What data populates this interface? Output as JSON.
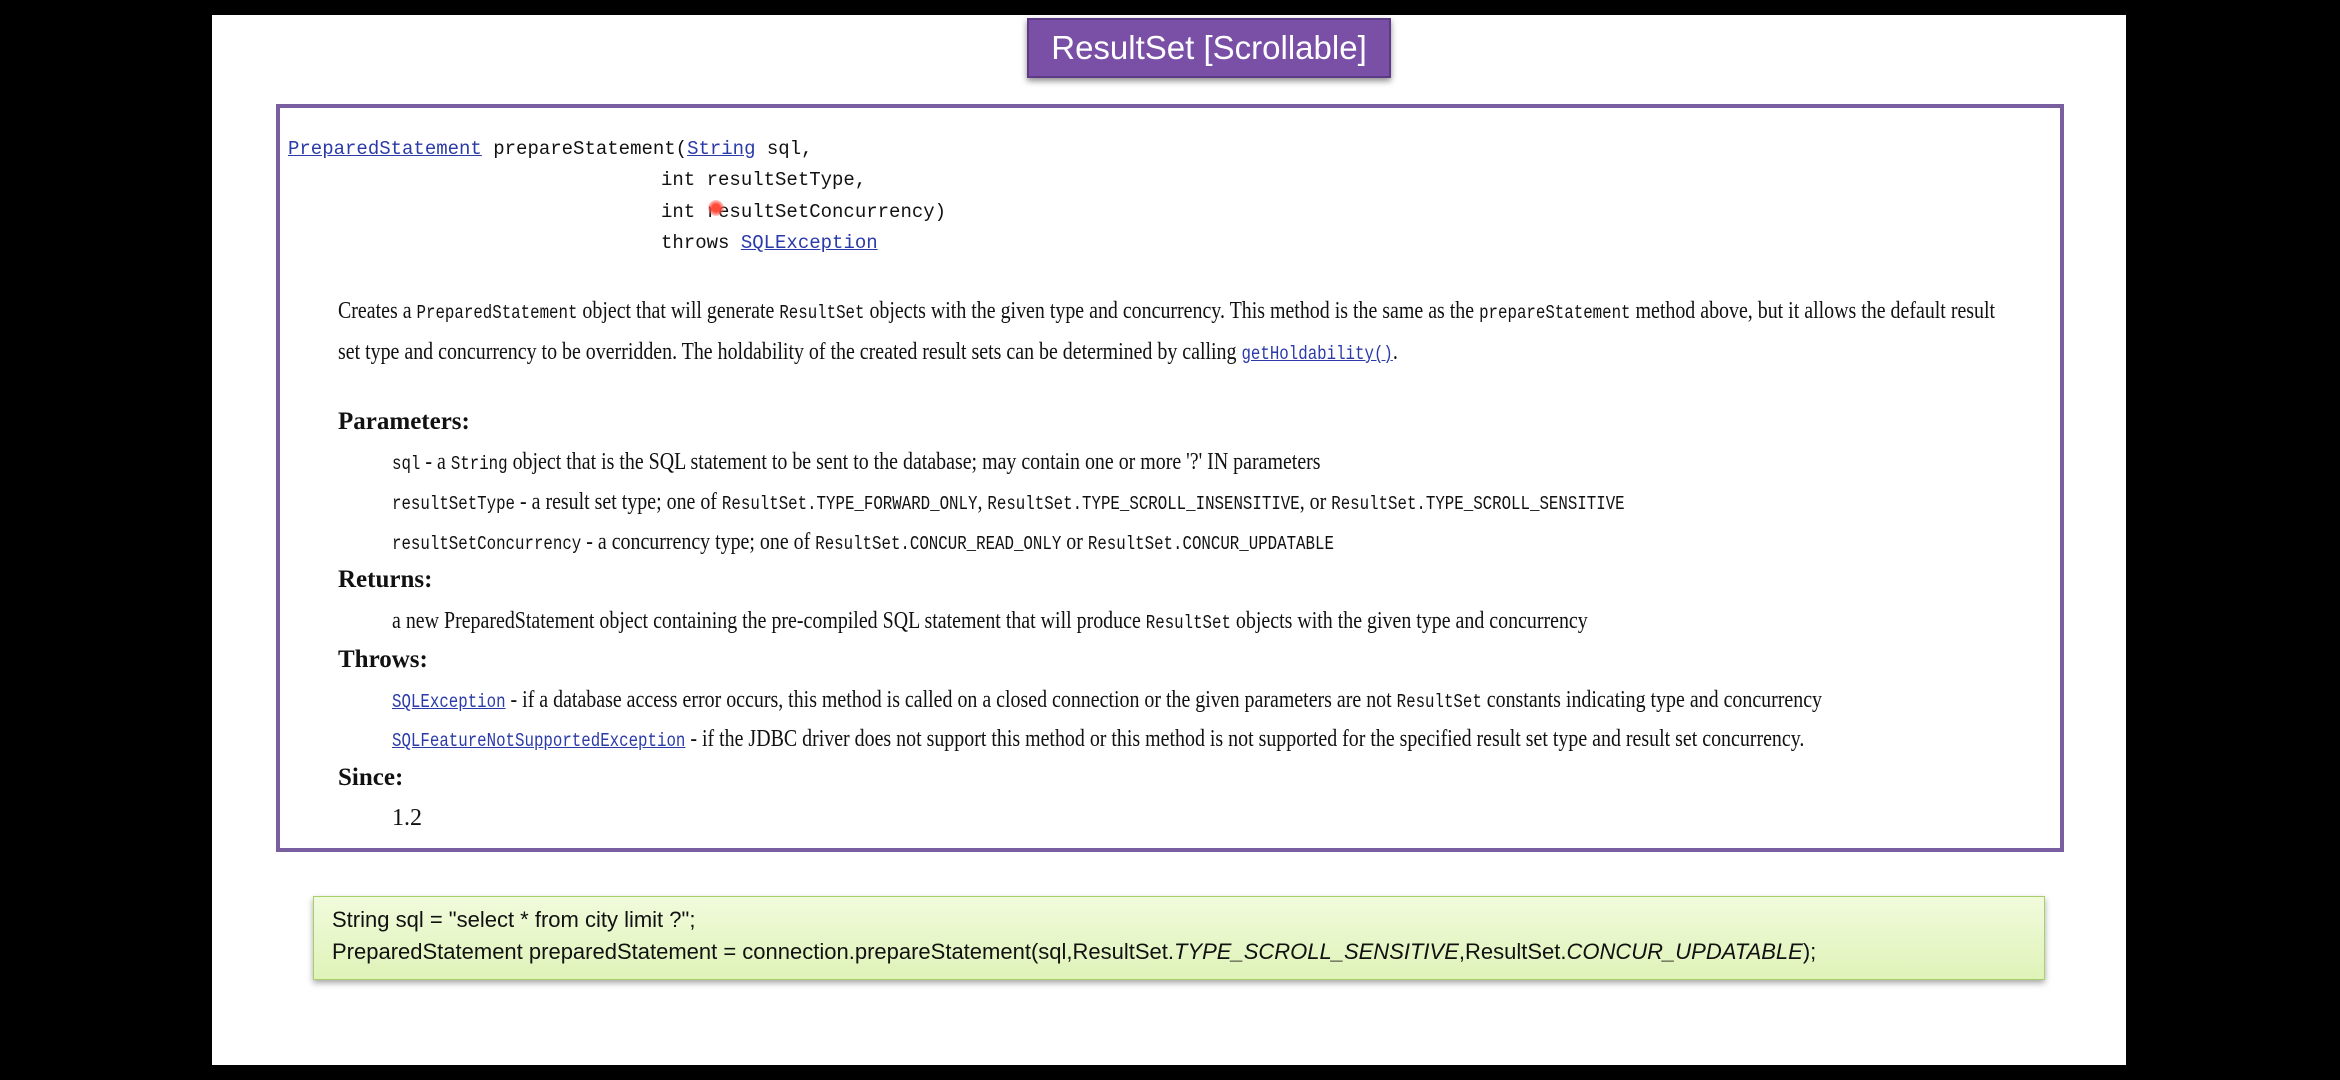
{
  "title": "ResultSet [Scrollable]",
  "signature": {
    "return_type": "PreparedStatement",
    "method": " prepareStatement(",
    "param1_type": "String",
    "param1_name": " sql,",
    "line2": "int resultSetType,",
    "line3": "int resultSetConcurrency)",
    "throws_kw": "throws ",
    "throws_type": "SQLException"
  },
  "description": {
    "l1_a": "Creates a ",
    "l1_code1": "PreparedStatement",
    "l1_b": " object that will generate ",
    "l1_code2": "ResultSet",
    "l1_c": " objects with the given type and concurrency. This method is the same as the ",
    "l1_code3": "prepareStatement",
    "l1_d": " method above, but it allows the default result",
    "l2_a": "set type and concurrency to be overridden. The holdability of the created result sets can be determined by calling ",
    "l2_link": "getHoldability()",
    "l2_b": "."
  },
  "parameters": {
    "header": "Parameters:",
    "p1_name": "sql",
    "p1_a": " - a ",
    "p1_code": "String",
    "p1_b": " object that is the SQL statement to be sent to the database; may contain one or more '?' IN parameters",
    "p2_name": "resultSetType",
    "p2_a": " - a result set type; one of ",
    "p2_c1": "ResultSet.TYPE_FORWARD_ONLY",
    "p2_sep1": ", ",
    "p2_c2": "ResultSet.TYPE_SCROLL_INSENSITIVE",
    "p2_sep2": ", or ",
    "p2_c3": "ResultSet.TYPE_SCROLL_SENSITIVE",
    "p3_name": "resultSetConcurrency",
    "p3_a": " - a concurrency type; one of ",
    "p3_c1": "ResultSet.CONCUR_READ_ONLY",
    "p3_sep": " or ",
    "p3_c2": "ResultSet.CONCUR_UPDATABLE"
  },
  "returns": {
    "header": "Returns:",
    "a": "a new PreparedStatement object containing the pre-compiled SQL statement that will produce ",
    "code": "ResultSet",
    "b": " objects with the given type and concurrency"
  },
  "throws": {
    "header": "Throws:",
    "t1_link": "SQLException",
    "t1_a": " - if a database access error occurs, this method is called on a closed connection or the given parameters are not ",
    "t1_code": "ResultSet",
    "t1_b": " constants indicating type and concurrency",
    "t2_link": "SQLFeatureNotSupportedException",
    "t2_a": " - if the JDBC driver does not support this method or this method is not supported for the specified result set type and result set concurrency."
  },
  "since": {
    "header": "Since:",
    "value": "1.2"
  },
  "code": {
    "line1": "String sql = \"select * from city limit ?\";",
    "line2_a": "PreparedStatement preparedStatement = connection.prepareStatement(sql,ResultSet.",
    "line2_i1": "TYPE_SCROLL_SENSITIVE",
    "line2_b": ",ResultSet.",
    "line2_i2": "CONCUR_UPDATABLE",
    "line2_c": ");"
  },
  "colors": {
    "title_bg": "#7a4fa6",
    "doc_border": "#7a5fa0",
    "link": "#2a3aa8",
    "code_bg": "#e8f7c8"
  }
}
